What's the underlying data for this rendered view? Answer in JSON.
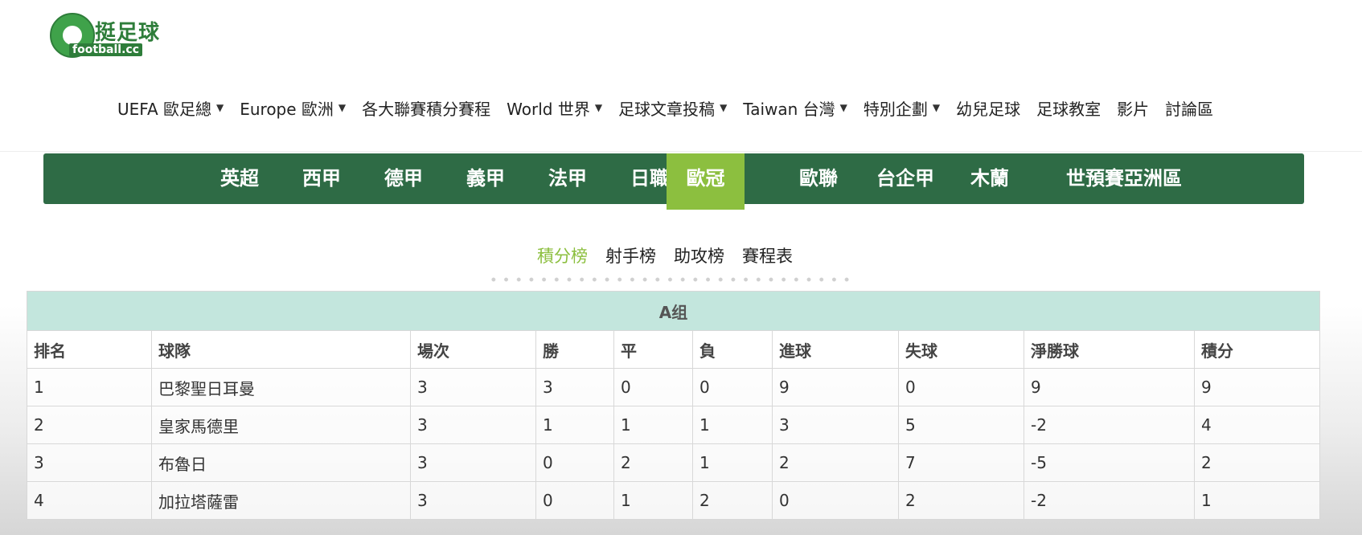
{
  "logo": {
    "title": "挺足球",
    "subtitle": "football.cc"
  },
  "main_nav": [
    {
      "label": "UEFA 歐足總",
      "dropdown": true
    },
    {
      "label": "Europe 歐洲",
      "dropdown": true
    },
    {
      "label": "各大聯賽積分賽程",
      "dropdown": false
    },
    {
      "label": "World 世界",
      "dropdown": true
    },
    {
      "label": "足球文章投稿",
      "dropdown": true
    },
    {
      "label": "Taiwan 台灣",
      "dropdown": true
    },
    {
      "label": "特別企劃",
      "dropdown": true
    },
    {
      "label": "幼兒足球",
      "dropdown": false
    },
    {
      "label": "足球教室",
      "dropdown": false
    },
    {
      "label": "影片",
      "dropdown": false
    },
    {
      "label": "討論區",
      "dropdown": false
    }
  ],
  "league_tabs": [
    {
      "label": "英超",
      "active": false
    },
    {
      "label": "西甲",
      "active": false
    },
    {
      "label": "德甲",
      "active": false
    },
    {
      "label": "義甲",
      "active": false
    },
    {
      "label": "法甲",
      "active": false
    },
    {
      "label": "日職",
      "active": false
    },
    {
      "label": "歐冠",
      "active": true
    },
    {
      "label": "歐聯",
      "active": false
    },
    {
      "label": "台企甲",
      "active": false
    },
    {
      "label": "木蘭",
      "active": false
    },
    {
      "label": "世預賽亞洲區",
      "active": false
    }
  ],
  "sub_tabs": [
    {
      "label": "積分榜",
      "active": true
    },
    {
      "label": "射手榜",
      "active": false
    },
    {
      "label": "助攻榜",
      "active": false
    },
    {
      "label": "賽程表",
      "active": false
    }
  ],
  "standings": {
    "group": "A组",
    "headers": [
      "排名",
      "球隊",
      "場次",
      "勝",
      "平",
      "負",
      "進球",
      "失球",
      "淨勝球",
      "積分"
    ],
    "rows": [
      [
        "1",
        "巴黎聖日耳曼",
        "3",
        "3",
        "0",
        "0",
        "9",
        "0",
        "9",
        "9"
      ],
      [
        "2",
        "皇家馬德里",
        "3",
        "1",
        "1",
        "1",
        "3",
        "5",
        "-2",
        "4"
      ],
      [
        "3",
        "布魯日",
        "3",
        "0",
        "2",
        "1",
        "2",
        "7",
        "-5",
        "2"
      ],
      [
        "4",
        "加拉塔薩雷",
        "3",
        "0",
        "1",
        "2",
        "0",
        "2",
        "-2",
        "1"
      ]
    ]
  },
  "colors": {
    "primary_green": "#2e6b45",
    "accent_green": "#8cbf3f",
    "group_header_bg": "#c3e6dd"
  }
}
